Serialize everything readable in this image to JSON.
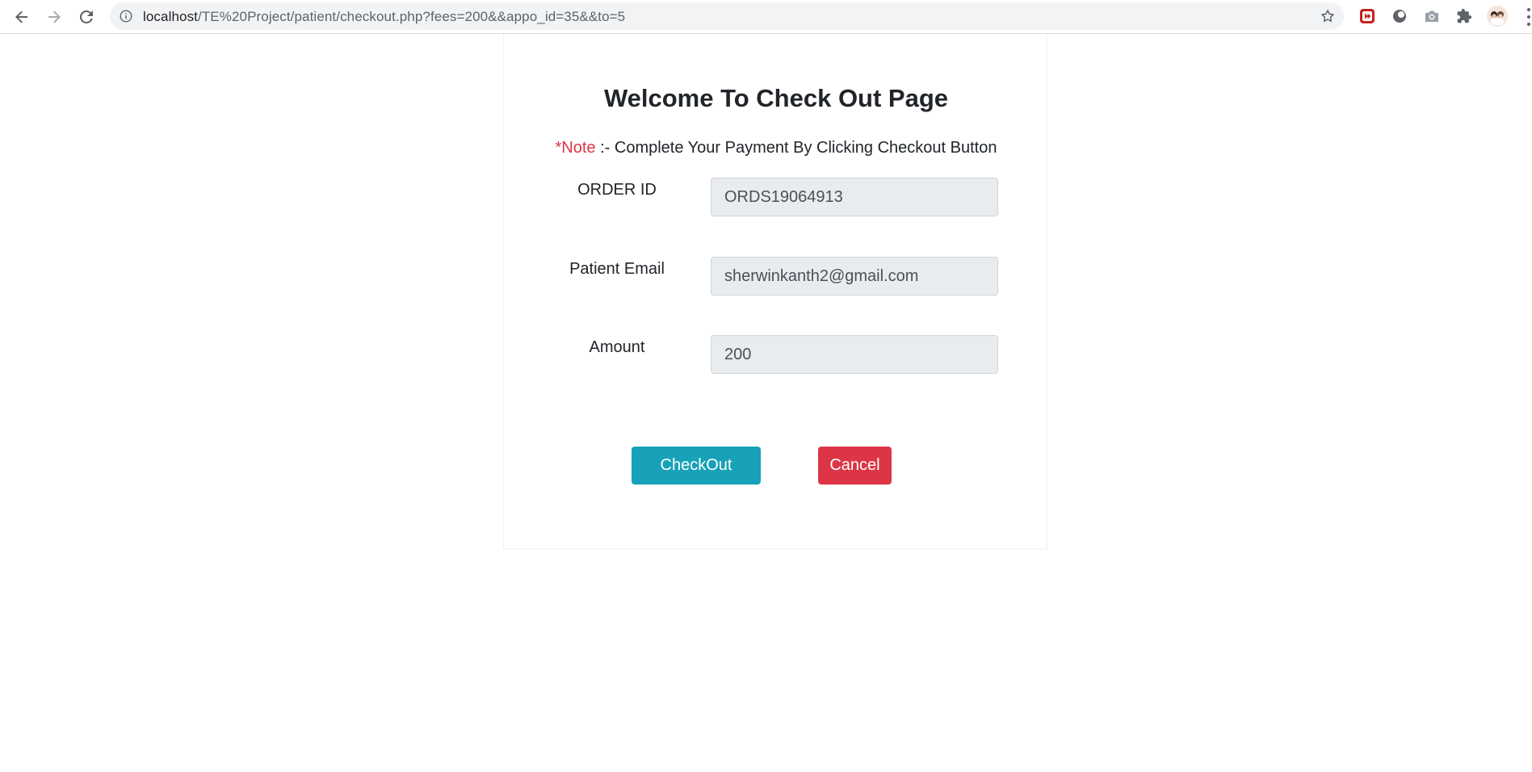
{
  "browser": {
    "url_host": "localhost",
    "url_path": "/TE%20Project/patient/checkout.php?fees=200&&appo_id=35&&to=5",
    "icons": [
      "back-arrow-icon",
      "forward-arrow-icon",
      "reload-icon",
      "info-icon",
      "star-icon",
      "record-extension-icon",
      "circle-extension-icon",
      "camera-extension-icon",
      "puzzle-extension-icon",
      "profile-avatar-icon",
      "menu-dots-icon"
    ]
  },
  "page": {
    "title": "Welcome To Check Out Page",
    "note_label": "*Note",
    "note_text": " :- Complete Your Payment By Clicking Checkout Button"
  },
  "form": {
    "order_id_label": "ORDER ID",
    "order_id_value": "ORDS19064913",
    "email_label": "Patient Email",
    "email_value": "sherwinkanth2@gmail.com",
    "amount_label": "Amount",
    "amount_value": "200"
  },
  "actions": {
    "checkout_label": "CheckOut",
    "cancel_label": "Cancel"
  },
  "colors": {
    "checkout": "#17a2b8",
    "cancel": "#dc3545",
    "note": "#dc3545",
    "input_bg": "#e9ecef"
  }
}
